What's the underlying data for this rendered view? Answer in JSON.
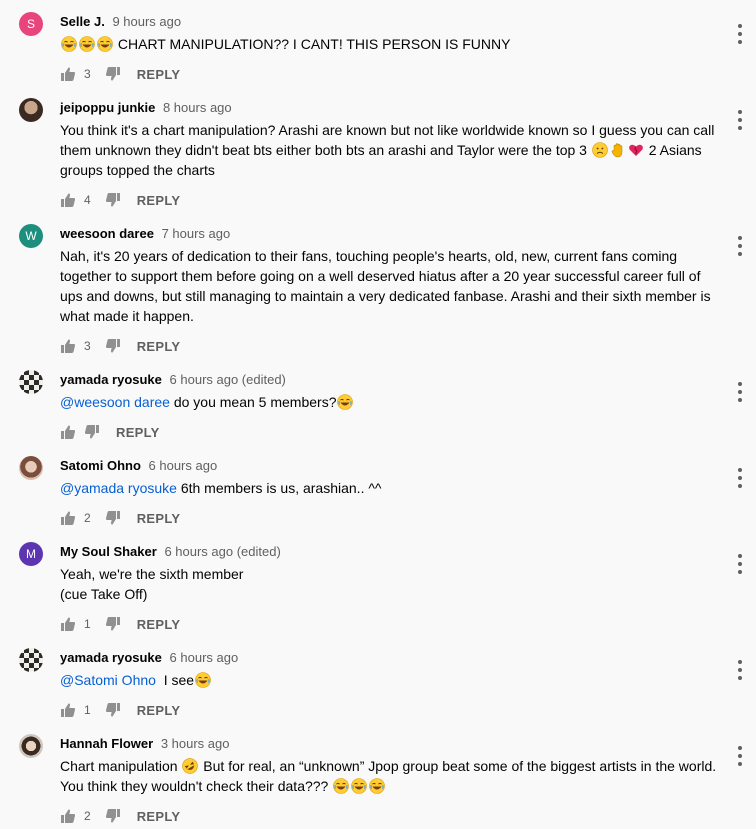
{
  "comments": [
    {
      "author": "Selle J.",
      "time": "9 hours ago",
      "avatar_letter": "S",
      "avatar_color": "#e8457c",
      "text_after": "CHART MANIPULATION?? I CANT! THIS PERSON IS FUNNY",
      "leading_emojis": [
        "joy",
        "joy",
        "joy"
      ],
      "likes": "3",
      "reply_label": "REPLY"
    },
    {
      "author": "jeipoppu junkie",
      "time": "8 hours ago",
      "avatar_style": "photo-dark",
      "text_lines": [
        "You think it's a chart manipulation? Arashi are known but not like worldwide known so I guess you can call",
        "them unknown they didn't beat bts either both bts an arashi and Taylor were the top 3",
        "2 Asians",
        "groups topped the charts"
      ],
      "inline_emojis": [
        "slight-frown",
        "raised-hand",
        "heart"
      ],
      "likes": "4",
      "reply_label": "REPLY"
    },
    {
      "author": "weesoon daree",
      "time": "7 hours ago",
      "avatar_letter": "W",
      "avatar_color": "#1e8f7e",
      "text_lines": [
        "Nah, it's 20 years of dedication to their fans, touching people's hearts, old, new, current fans coming",
        "together to support them before going on a well deserved hiatus after a 20 year successful career full of",
        "ups and downs, but still managing to maintain a very dedicated fanbase. Arashi and their sixth member is",
        "what made it happen."
      ],
      "likes": "3",
      "reply_label": "REPLY"
    },
    {
      "author": "yamada ryosuke",
      "time": "6 hours ago (edited)",
      "avatar_style": "panda-pattern",
      "mention": "@weesoon daree",
      "text_after": " do you mean 5 members?",
      "trailing_emojis": [
        "joy"
      ],
      "likes": "",
      "reply_label": "REPLY"
    },
    {
      "author": "Satomi Ohno",
      "time": "6 hours ago",
      "avatar_style": "photo-light",
      "mention": "@yamada ryosuke",
      "text_after": " 6th members is us, arashian.. ^^",
      "likes": "2",
      "reply_label": "REPLY"
    },
    {
      "author": "My Soul Shaker",
      "time": "6 hours ago (edited)",
      "avatar_letter": "M",
      "avatar_color": "#5e35b1",
      "text_lines": [
        "Yeah, we're the sixth member",
        "(cue Take Off)"
      ],
      "likes": "1",
      "reply_label": "REPLY"
    },
    {
      "author": "yamada ryosuke",
      "time": "6 hours ago",
      "avatar_style": "panda-pattern",
      "mention": "@Satomi Ohno",
      "text_after": "  I see",
      "trailing_emojis": [
        "joy"
      ],
      "likes": "1",
      "reply_label": "REPLY"
    },
    {
      "author": "Hannah Flower",
      "time": "3 hours ago",
      "avatar_style": "photo-face",
      "text_lines": [
        "Chart manipulation",
        "But for real, an “unknown” Jpop group beat some of the biggest artists in the world.",
        "You think they wouldn't check their data???"
      ],
      "inline_emojis": [
        "rofl",
        "joy",
        "joy",
        "joy"
      ],
      "likes": "2",
      "reply_label": "REPLY"
    }
  ],
  "icons": {
    "like": "thumbs-up-icon",
    "dislike": "thumbs-down-icon",
    "more": "more-vert-icon"
  },
  "colors": {
    "background": "#f9f9f9",
    "link": "#065fd4",
    "secondary_text": "#606060"
  }
}
